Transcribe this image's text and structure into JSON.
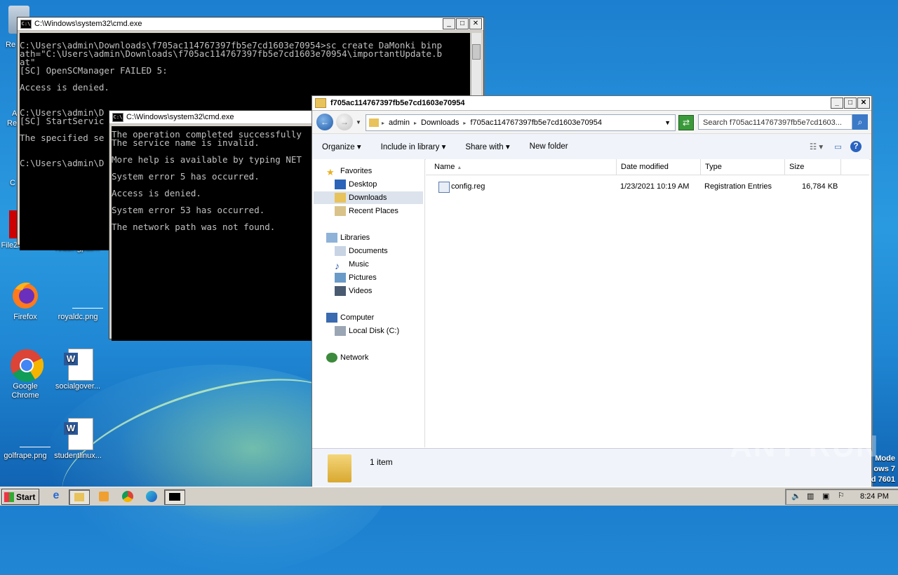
{
  "desktop": {
    "icons": [
      {
        "label": "Re",
        "name": "recycle-bin-icon"
      },
      {
        "label": "FileZilla Client",
        "name": "filezilla-icon"
      },
      {
        "label": "readingpati...",
        "name": "readingpati-icon"
      },
      {
        "label": "Firefox",
        "name": "firefox-icon"
      },
      {
        "label": "royaldc.png",
        "name": "royaldc-icon"
      },
      {
        "label": "Google Chrome",
        "name": "chrome-icon"
      },
      {
        "label": "socialgover...",
        "name": "socialgover-icon"
      },
      {
        "label": "golfrape.png",
        "name": "golfrape-icon"
      },
      {
        "label": "studentlinux...",
        "name": "studentlinux-icon"
      }
    ],
    "edge_labels": [
      "Re",
      "A",
      "Re",
      "C"
    ],
    "watermark": "ANY RUN",
    "os_text": [
      "Mode",
      "ows 7",
      "d 7601"
    ]
  },
  "cmd1": {
    "title": "C:\\Windows\\system32\\cmd.exe",
    "lines": [
      "C:\\Users\\admin\\Downloads\\f705ac114767397fb5e7cd1603e70954>sc create DaMonki binp",
      "ath=\"C:\\Users\\admin\\Downloads\\f705ac114767397fb5e7cd1603e70954\\importantUpdate.b",
      "at\"",
      "[SC] OpenSCManager FAILED 5:",
      "",
      "Access is denied.",
      "",
      "",
      "C:\\Users\\admin\\D",
      "[SC] StartServic",
      "",
      "The specified se",
      "",
      "",
      "C:\\Users\\admin\\D"
    ]
  },
  "cmd2": {
    "title": "C:\\Windows\\system32\\cmd.exe",
    "lines": [
      "The operation completed successfully",
      "The service name is invalid.",
      "",
      "More help is available by typing NET",
      "",
      "System error 5 has occurred.",
      "",
      "Access is denied.",
      "",
      "System error 53 has occurred.",
      "",
      "The network path was not found."
    ]
  },
  "explorer": {
    "title": "f705ac114767397fb5e7cd1603e70954",
    "breadcrumb": [
      "admin",
      "Downloads",
      "f705ac114767397fb5e7cd1603e70954"
    ],
    "search_placeholder": "Search f705ac114767397fb5e7cd1603...",
    "toolbar": {
      "organize": "Organize",
      "include": "Include in library",
      "share": "Share with",
      "new_folder": "New folder"
    },
    "nav": {
      "favorites": "Favorites",
      "desktop": "Desktop",
      "downloads": "Downloads",
      "recent": "Recent Places",
      "libraries": "Libraries",
      "documents": "Documents",
      "music": "Music",
      "pictures": "Pictures",
      "videos": "Videos",
      "computer": "Computer",
      "localdisk": "Local Disk (C:)",
      "network": "Network"
    },
    "columns": {
      "name": "Name",
      "date": "Date modified",
      "type": "Type",
      "size": "Size"
    },
    "files": [
      {
        "name": "config.reg",
        "date": "1/23/2021 10:19 AM",
        "type": "Registration Entries",
        "size": "16,784 KB"
      }
    ],
    "status": "1 item"
  },
  "taskbar": {
    "start": "Start",
    "time": "8:24 PM"
  }
}
